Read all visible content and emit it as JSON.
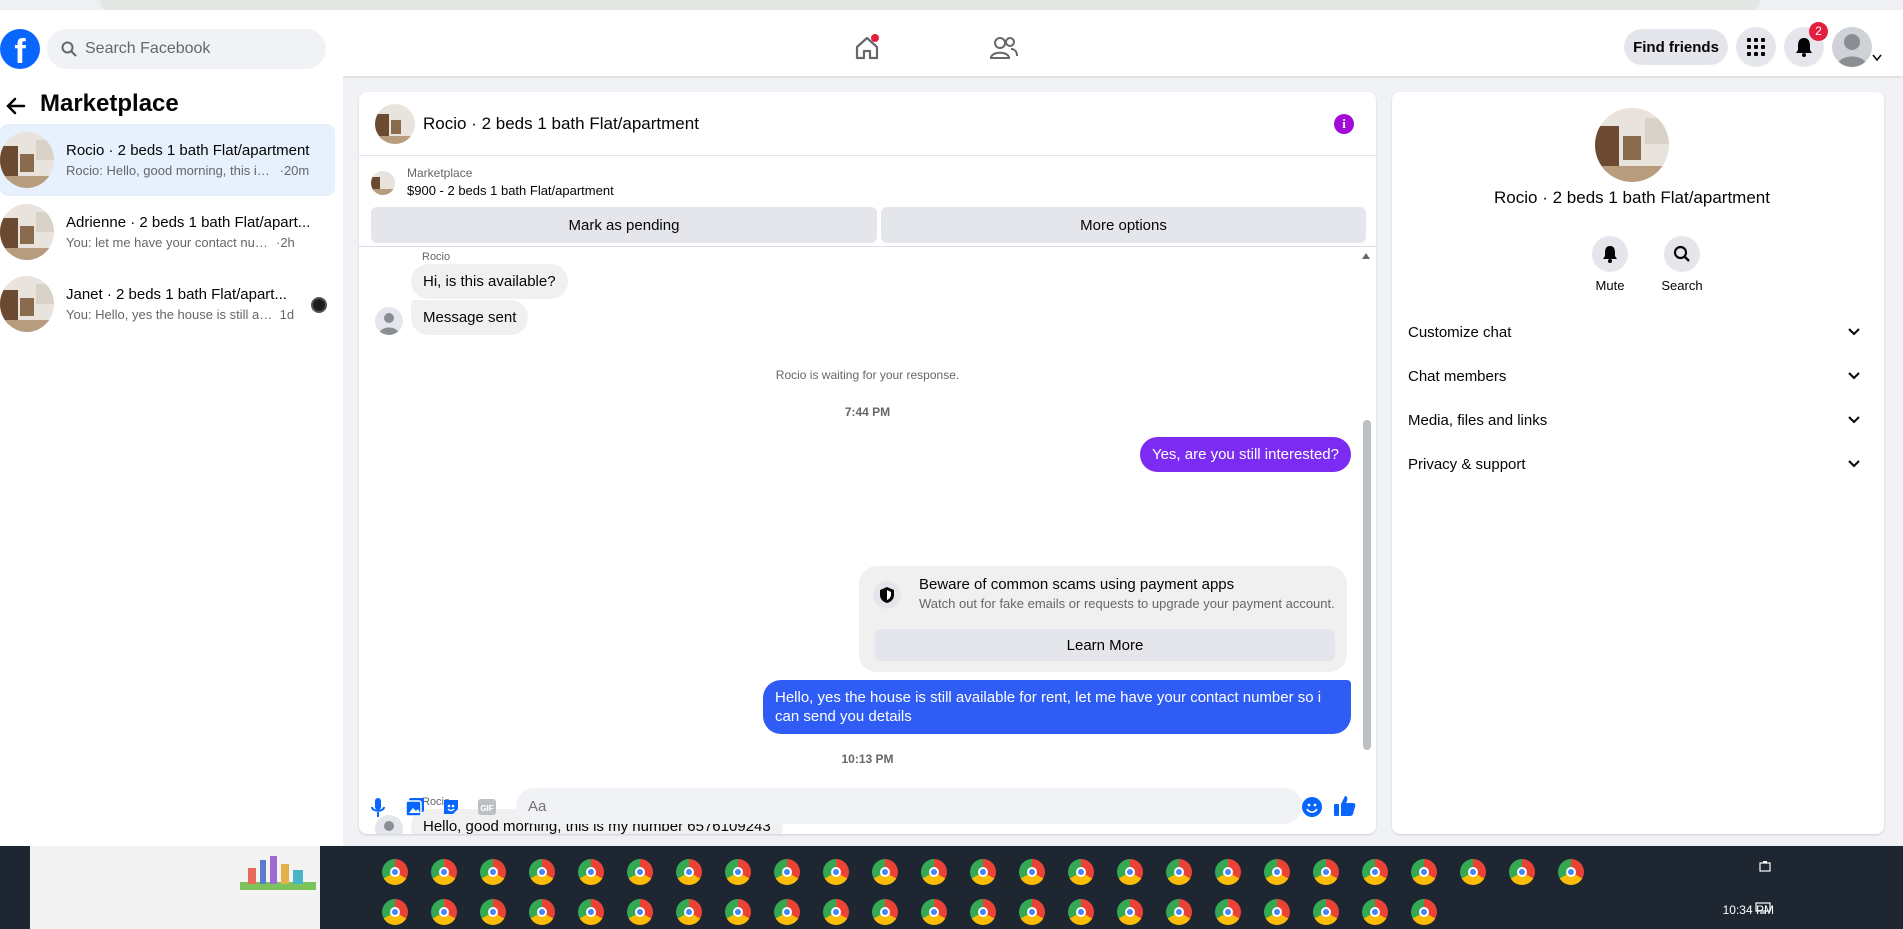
{
  "topbar": {
    "search_placeholder": "Search Facebook",
    "find_friends": "Find friends",
    "notification_count": "2",
    "brand_color": "#0866ff"
  },
  "sidebar": {
    "title": "Marketplace",
    "conversations": [
      {
        "name": "Rocio · 2 beds 1 bath Flat/apartment",
        "preview": "Rocio: Hello, good morning, this is ...",
        "time": "·20m",
        "active": true
      },
      {
        "name": "Adrienne · 2 beds 1 bath Flat/apart...",
        "preview": "You: let me have your contact number...",
        "time": "·2h",
        "active": false
      },
      {
        "name": "Janet · 2 beds 1 bath Flat/apart...",
        "preview": "You: Hello, yes the house is still ava...",
        "time": "1d",
        "active": false
      }
    ]
  },
  "chat": {
    "header_name": "Rocio · 2 beds 1 bath Flat/apartment",
    "listing_label": "Marketplace",
    "listing_price": "$900 - 2 beds 1 bath Flat/apartment",
    "mark_pending": "Mark as pending",
    "more_options": "More options",
    "sender_1": "Rocio",
    "msg_1": "Hi, is this available?",
    "msg_2": "Message sent",
    "waiting": "Rocio is waiting for your response.",
    "time_1": "7:44 PM",
    "out_1": "Yes, are you still interested?",
    "scam_title": "Beware of common scams using payment apps",
    "scam_desc": "Watch out for fake emails or requests to upgrade your payment account.",
    "learn_more": "Learn More",
    "out_2": "Hello, yes the house is still available for rent, let me have your contact number so i can send you details",
    "time_2": "10:13 PM",
    "sender_2": "Rocio",
    "msg_3": "Hello, good morning, this is my number 6576109243",
    "composer_placeholder": "Aa",
    "out_color_1": "#7c2cf2",
    "out_color_2": "#2f5cf5"
  },
  "details": {
    "name": "Rocio · 2 beds 1 bath Flat/apartment",
    "mute": "Mute",
    "search": "Search",
    "sections": [
      "Customize chat",
      "Chat members",
      "Media, files and links",
      "Privacy & support"
    ]
  },
  "taskbar": {
    "time": "10:34 PM"
  }
}
